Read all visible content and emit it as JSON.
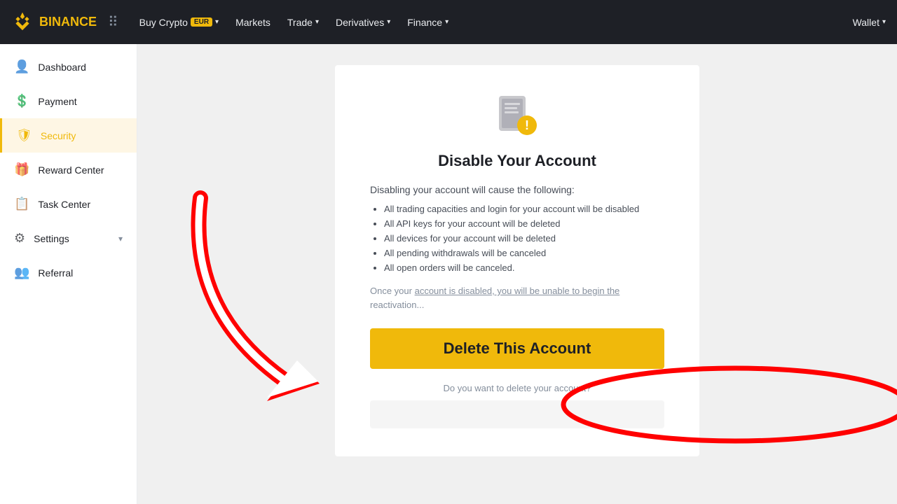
{
  "topnav": {
    "logo_text": "BINANCE",
    "nav_items": [
      {
        "label": "Buy Crypto",
        "badge": "EUR",
        "has_badge": true
      },
      {
        "label": "Markets",
        "has_badge": false
      },
      {
        "label": "Trade",
        "has_badge": false
      },
      {
        "label": "Derivatives",
        "has_badge": false
      },
      {
        "label": "Finance",
        "has_badge": false
      }
    ],
    "wallet_label": "Wallet"
  },
  "sidebar": {
    "items": [
      {
        "label": "Dashboard",
        "icon": "👤",
        "active": false
      },
      {
        "label": "Payment",
        "icon": "💰",
        "active": false
      },
      {
        "label": "Security",
        "icon": "🛡",
        "active": true
      },
      {
        "label": "Reward Center",
        "icon": "🎁",
        "active": false
      },
      {
        "label": "Task Center",
        "icon": "📋",
        "active": false
      },
      {
        "label": "Settings",
        "icon": "⚙",
        "active": false,
        "has_arrow": true
      },
      {
        "label": "Referral",
        "icon": "👥",
        "active": false
      }
    ]
  },
  "modal": {
    "title": "Disable Your Account",
    "subtitle": "Disabling your account will cause the following:",
    "list_items": [
      "All trading capacities and login for your account will be disabled",
      "All API keys for your account will be deleted",
      "All devices for your account will be deleted",
      "All pending withdrawals will be canceled",
      "All open orders will be canceled."
    ],
    "note": "Once your account is disabled, you will be unable to begin the reactivation...",
    "note_underline_start": 14,
    "note_underline_end": 52,
    "delete_button_label": "Delete This Account",
    "question_text": "Do you want to delete your account?",
    "input_placeholder": ""
  }
}
